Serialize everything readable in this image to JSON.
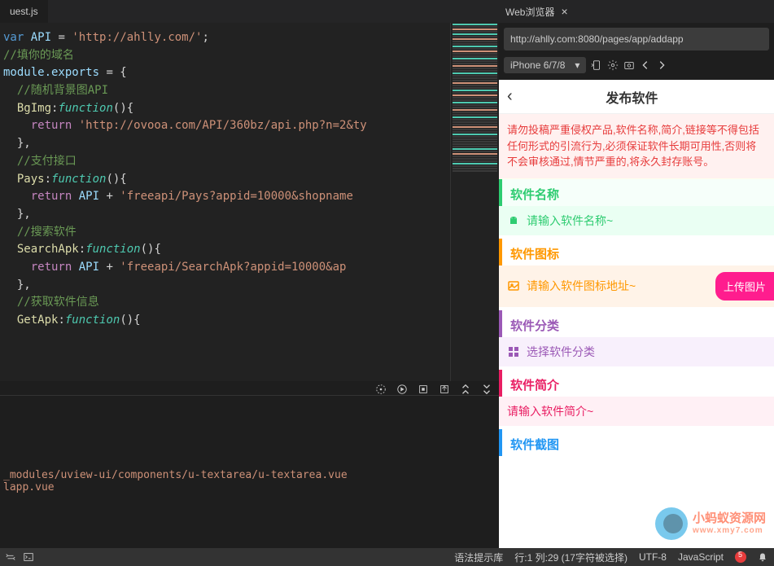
{
  "editor": {
    "tab_name": "uest.js",
    "code": {
      "l1_var": "var",
      "l1_api": " API ",
      "l1_eq": "= ",
      "l1_str": "'http://ahlly.com/'",
      "l1_semi": ";",
      "l2_comment": "//填你的域名",
      "l3_module": "module.exports ",
      "l3_eq": "= {",
      "l4_comment": "  //随机背景图API",
      "l5_name": "  BgImg",
      "l5_colon": ":",
      "l5_func": "function",
      "l5_paren": "(){",
      "l6_return": "    return ",
      "l6_str": "'http://ovooa.com/API/360bz/api.php?n=2&ty",
      "l7_close": "  },",
      "l8_comment": "  //支付接口",
      "l9_name": "  Pays",
      "l9_func": "function",
      "l9_paren": "(){",
      "l10_return": "    return ",
      "l10_api": "API ",
      "l10_plus": "+ ",
      "l10_str": "'freeapi/Pays?appid=10000&shopname",
      "l11_close": "  },",
      "l12_comment": "  //搜索软件",
      "l13_name": "  SearchApk",
      "l13_func": "function",
      "l13_paren": "(){",
      "l14_return": "    return ",
      "l14_api": "API ",
      "l14_plus": "+ ",
      "l14_str": "'freeapi/SearchApk?appid=10000&ap",
      "l15_close": "  },",
      "l16_comment": "  //获取软件信息",
      "l17_name": "  GetApk",
      "l17_func": "function",
      "l17_paren": "(){"
    }
  },
  "terminal": {
    "line1": "_modules/uview-ui/components/u-textarea/u-textarea.vue",
    "line2": "lapp.vue"
  },
  "status": {
    "grammar": "语法提示库",
    "position": "行:1  列:29 (17字符被选择)",
    "encoding": "UTF-8",
    "language": "JavaScript"
  },
  "browser": {
    "tab_title": "Web浏览器",
    "url": "http://ahlly.com:8080/pages/app/addapp",
    "device": "iPhone 6/7/8"
  },
  "preview": {
    "title": "发布软件",
    "warning": "请勿投稿严重侵权产品,软件名称,简介,链接等不得包括任何形式的引流行为,必须保证软件长期可用性,否则将不会审核通过,情节严重的,将永久封存账号。",
    "sections": {
      "name_label": "软件名称",
      "name_placeholder": "请输入软件名称~",
      "icon_label": "软件图标",
      "icon_placeholder": "请输入软件图标地址~",
      "upload_btn": "上传图片",
      "category_label": "软件分类",
      "category_placeholder": "选择软件分类",
      "intro_label": "软件简介",
      "intro_placeholder": "请输入软件简介~",
      "screenshot_label": "软件截图"
    }
  },
  "watermark": {
    "text": "小蚂蚁资源网",
    "sub": "www.xmy7.com"
  }
}
